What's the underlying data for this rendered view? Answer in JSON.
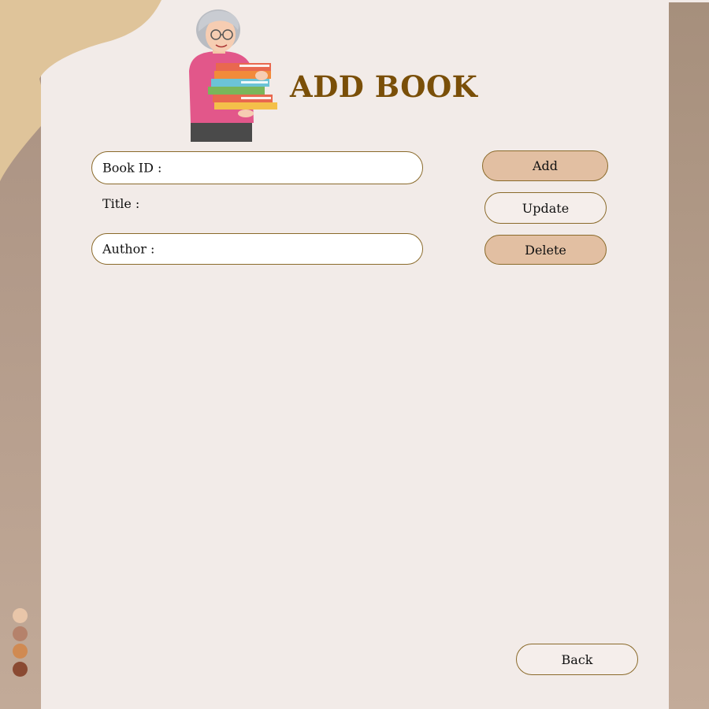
{
  "header": {
    "title": "ADD BOOK"
  },
  "form": {
    "book_id_label": "Book ID :",
    "title_label": "Title :",
    "author_label": "Author :"
  },
  "actions": {
    "add": "Add",
    "update": "Update",
    "delete": "Delete",
    "back": "Back"
  },
  "colors": {
    "title": "#7a4f08",
    "button_filled": "#e2bfa2",
    "button_outline": "#f5eeeb",
    "background": "#f2ebe8",
    "band": "#b29b89",
    "blob": "#dfc49a"
  },
  "palette_swatches": [
    "#e9c6a9",
    "#b5826b",
    "#d08a52",
    "#8a4a32"
  ],
  "icons": {
    "illustration": "woman-holding-books-illustration"
  }
}
